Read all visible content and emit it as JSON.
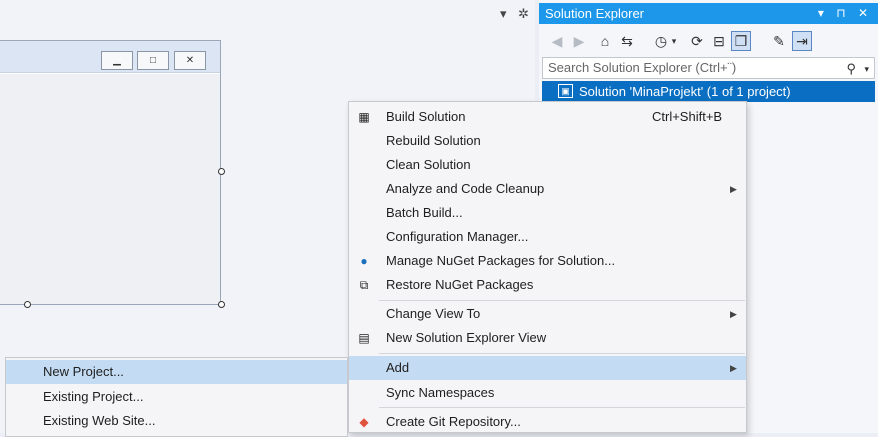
{
  "designer": {
    "topbar_icons": [
      "chevron-down-icon",
      "gear-icon"
    ],
    "form_caption_buttons": [
      "minimize-icon",
      "maximize-icon",
      "close-icon"
    ]
  },
  "solution_explorer": {
    "title": "Solution Explorer",
    "title_actions": [
      "▾",
      "⊓",
      "✕"
    ],
    "search_placeholder": "Search Solution Explorer (Ctrl+¨)",
    "solution_label": "Solution 'MinaProjekt' (1 of 1 project)",
    "accent": "#1c97ea",
    "selection": "#0a6fc2"
  },
  "context_menu": {
    "items": [
      {
        "icon": "build-icon",
        "label": "Build Solution",
        "shortcut": "Ctrl+Shift+B"
      },
      {
        "label": "Rebuild Solution"
      },
      {
        "label": "Clean Solution"
      },
      {
        "label": "Analyze and Code Cleanup",
        "submenu": true
      },
      {
        "label": "Batch Build..."
      },
      {
        "label": "Configuration Manager..."
      },
      {
        "icon": "nuget-icon",
        "label": "Manage NuGet Packages for Solution..."
      },
      {
        "icon": "restore-packages-icon",
        "label": "Restore NuGet Packages"
      },
      {
        "label": "Change View To",
        "submenu": true
      },
      {
        "icon": "new-view-icon",
        "label": "New Solution Explorer View"
      },
      {
        "label": "Add",
        "submenu": true,
        "highlighted": true
      },
      {
        "label": "Sync Namespaces"
      },
      {
        "icon": "git-icon",
        "label": "Create Git Repository..."
      }
    ],
    "highlight": "#c4dcf3"
  },
  "add_submenu": {
    "items": [
      {
        "label": "New Project...",
        "highlighted": true
      },
      {
        "label": "Existing Project..."
      },
      {
        "label": "Existing Web Site..."
      }
    ]
  }
}
